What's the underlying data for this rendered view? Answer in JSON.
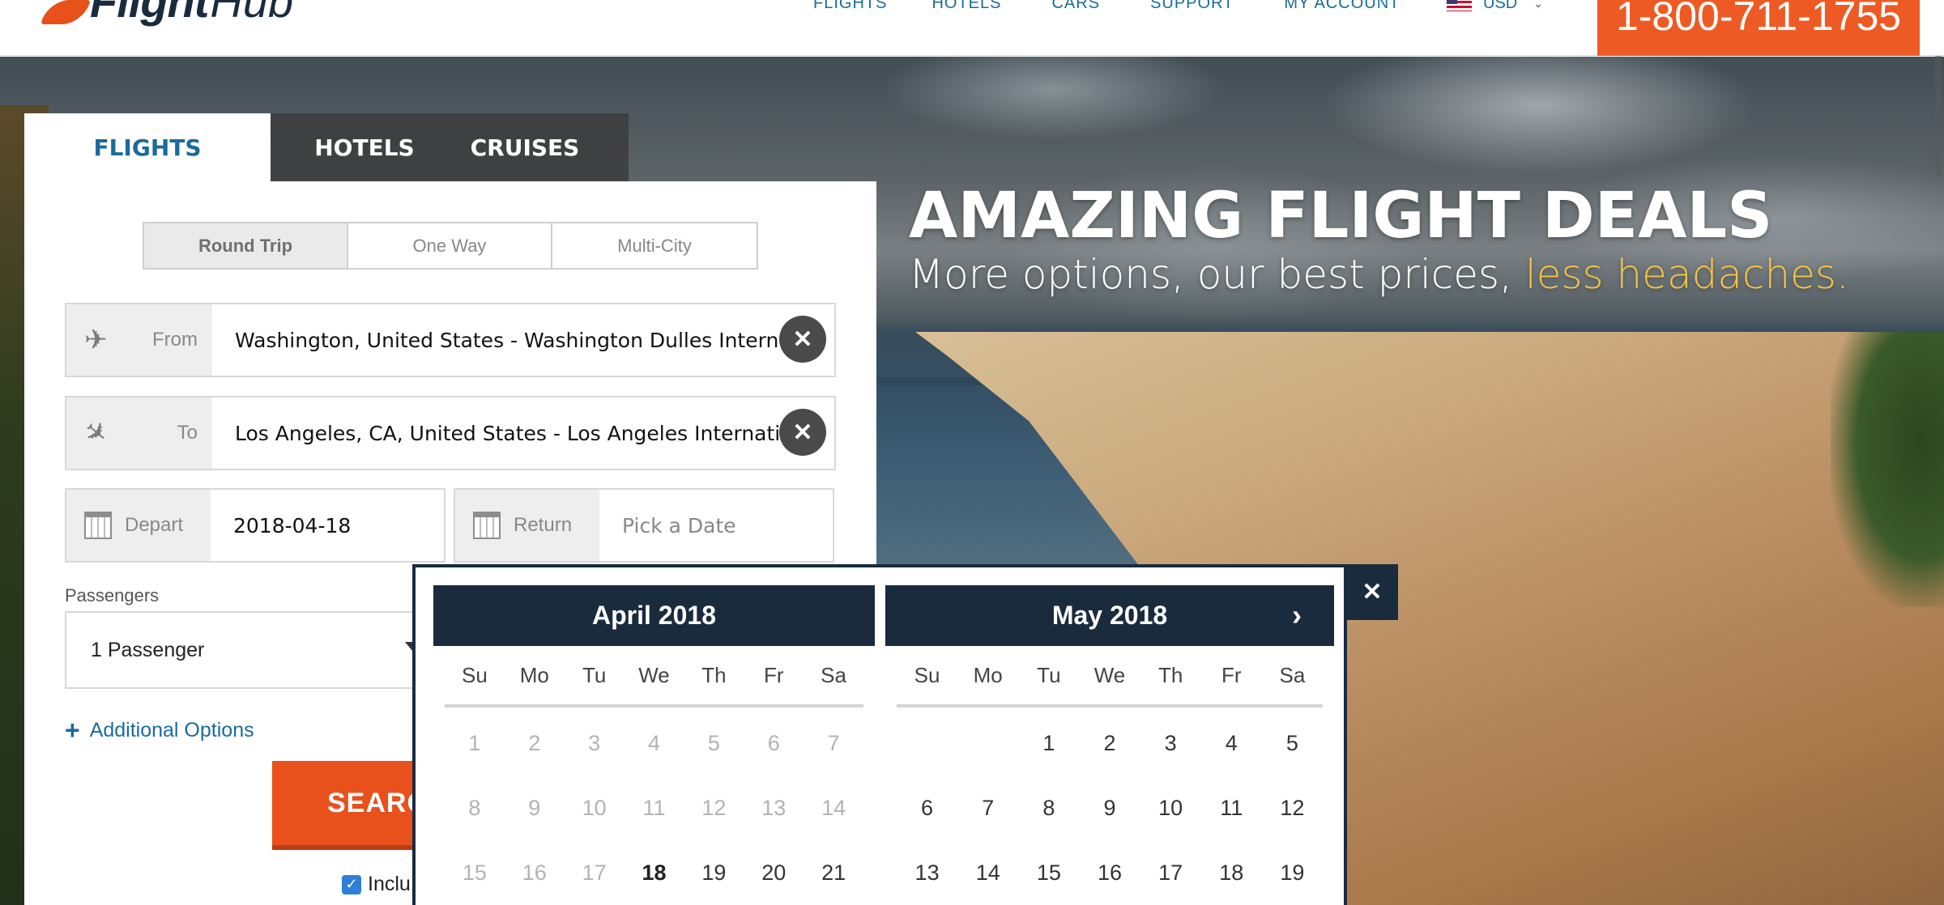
{
  "header": {
    "logo": {
      "main": "Flight",
      "sub": "Hub"
    },
    "nav": [
      "FLIGHTS",
      "HOTELS",
      "CARS",
      "SUPPORT",
      "MY ACCOUNT"
    ],
    "currency": "USD",
    "phone": "1-800-711-1755"
  },
  "hero": {
    "title": "AMAZING FLIGHT DEALS",
    "subtitle_main": "More options, our best prices, ",
    "subtitle_highlight": "less headaches."
  },
  "tabs": [
    "FLIGHTS",
    "HOTELS",
    "CRUISES"
  ],
  "trip_types": [
    "Round Trip",
    "One Way",
    "Multi-City"
  ],
  "form": {
    "from_label": "From",
    "from_value": "Washington, United States - Washington Dulles International",
    "to_label": "To",
    "to_value": "Los Angeles, CA, United States - Los Angeles International",
    "depart_label": "Depart",
    "depart_value": "2018-04-18",
    "return_label": "Return",
    "return_placeholder": "Pick a Date",
    "passengers_label": "Passengers",
    "passengers_value": "1 Passenger",
    "additional_options": "Additional Options",
    "search_label": "SEARC",
    "include_label": "Inclu"
  },
  "datepicker": {
    "weekdays": [
      "Su",
      "Mo",
      "Tu",
      "We",
      "Th",
      "Fr",
      "Sa"
    ],
    "months": [
      {
        "title": "April 2018",
        "weeks": [
          [
            {
              "d": "1",
              "s": "dis"
            },
            {
              "d": "2",
              "s": "dis"
            },
            {
              "d": "3",
              "s": "dis"
            },
            {
              "d": "4",
              "s": "dis"
            },
            {
              "d": "5",
              "s": "dis"
            },
            {
              "d": "6",
              "s": "dis"
            },
            {
              "d": "7",
              "s": "dis"
            }
          ],
          [
            {
              "d": "8",
              "s": "dis"
            },
            {
              "d": "9",
              "s": "dis"
            },
            {
              "d": "10",
              "s": "dis"
            },
            {
              "d": "11",
              "s": "dis"
            },
            {
              "d": "12",
              "s": "dis"
            },
            {
              "d": "13",
              "s": "dis"
            },
            {
              "d": "14",
              "s": "dis"
            }
          ],
          [
            {
              "d": "15",
              "s": "dis"
            },
            {
              "d": "16",
              "s": "dis"
            },
            {
              "d": "17",
              "s": "dis"
            },
            {
              "d": "18",
              "s": "sel"
            },
            {
              "d": "19",
              "s": ""
            },
            {
              "d": "20",
              "s": ""
            },
            {
              "d": "21",
              "s": ""
            }
          ]
        ]
      },
      {
        "title": "May 2018",
        "weeks": [
          [
            {
              "d": "",
              "s": ""
            },
            {
              "d": "",
              "s": ""
            },
            {
              "d": "1",
              "s": ""
            },
            {
              "d": "2",
              "s": ""
            },
            {
              "d": "3",
              "s": ""
            },
            {
              "d": "4",
              "s": ""
            },
            {
              "d": "5",
              "s": ""
            }
          ],
          [
            {
              "d": "6",
              "s": ""
            },
            {
              "d": "7",
              "s": ""
            },
            {
              "d": "8",
              "s": ""
            },
            {
              "d": "9",
              "s": ""
            },
            {
              "d": "10",
              "s": ""
            },
            {
              "d": "11",
              "s": ""
            },
            {
              "d": "12",
              "s": ""
            }
          ],
          [
            {
              "d": "13",
              "s": ""
            },
            {
              "d": "14",
              "s": ""
            },
            {
              "d": "15",
              "s": ""
            },
            {
              "d": "16",
              "s": ""
            },
            {
              "d": "17",
              "s": ""
            },
            {
              "d": "18",
              "s": ""
            },
            {
              "d": "19",
              "s": ""
            }
          ]
        ]
      }
    ],
    "next_icon": "chevron-right-icon",
    "close_icon": "close-icon"
  },
  "colors": {
    "accent": "#e8501c",
    "brand_link": "#1a6b9a",
    "navy": "#1b2b3e",
    "highlight": "#f6c343"
  }
}
